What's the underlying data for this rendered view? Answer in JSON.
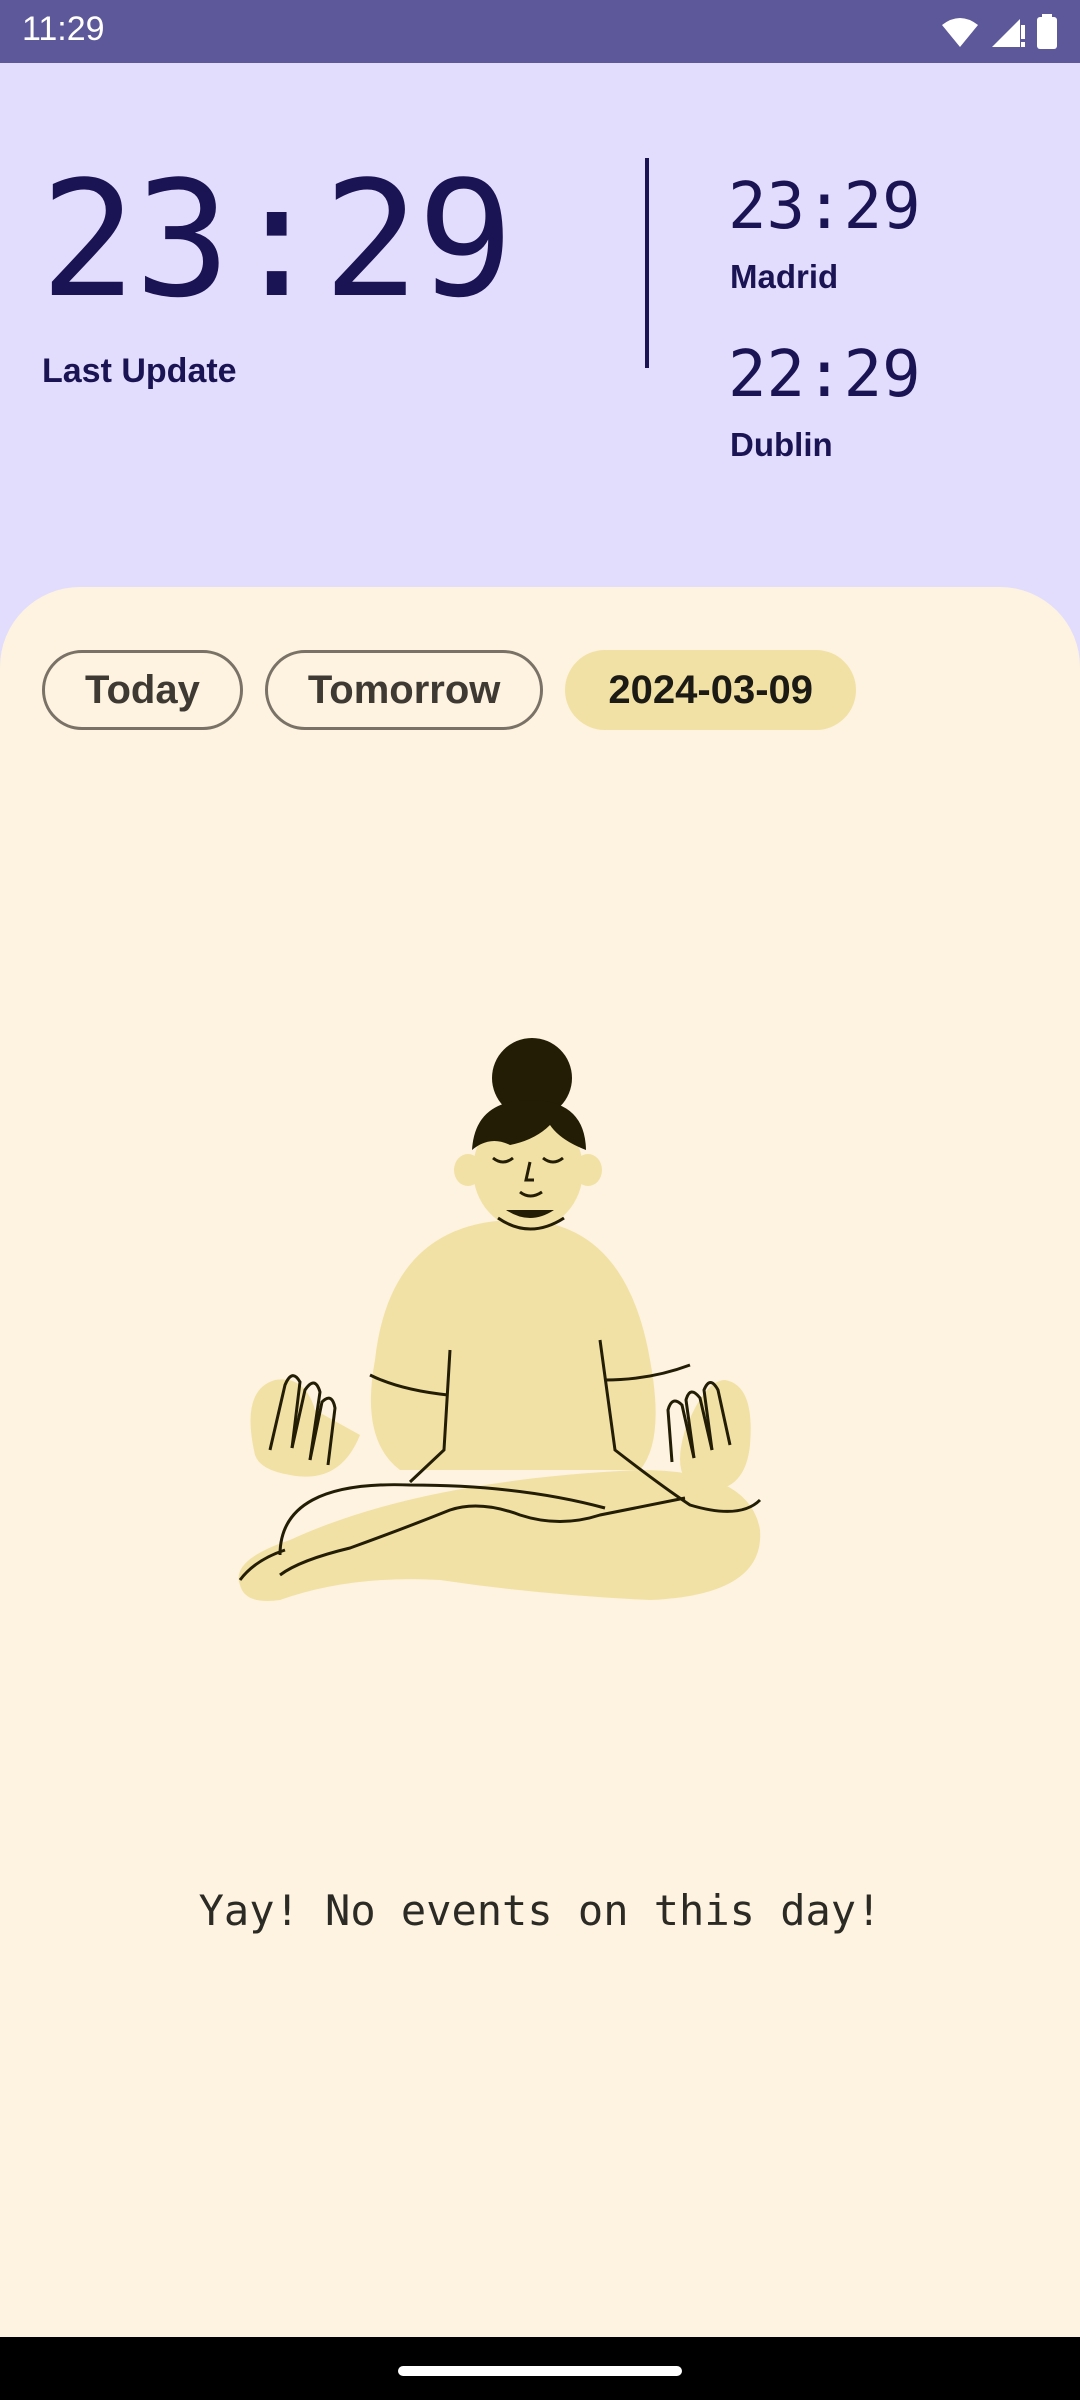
{
  "status_bar": {
    "time": "11:29",
    "icons": [
      "wifi-icon",
      "signal-icon",
      "battery-icon"
    ]
  },
  "header": {
    "main_time": "23:29",
    "last_update_label": "Last Update",
    "zones": [
      {
        "time": "23:29",
        "name": "Madrid"
      },
      {
        "time": "22:29",
        "name": "Dublin"
      }
    ]
  },
  "chips": [
    {
      "label": "Today",
      "selected": false
    },
    {
      "label": "Tomorrow",
      "selected": false
    },
    {
      "label": "2024-03-09",
      "selected": true
    }
  ],
  "empty_state": {
    "message": "Yay! No events on this day!",
    "illustration": "meditating-person-illustration"
  },
  "colors": {
    "status_bar": "#5d5899",
    "header_bg": "#e2ddfc",
    "sheet_bg": "#fdf3e0",
    "text_dark_blue": "#1b1454",
    "chip_selected": "#f2e1a4"
  }
}
